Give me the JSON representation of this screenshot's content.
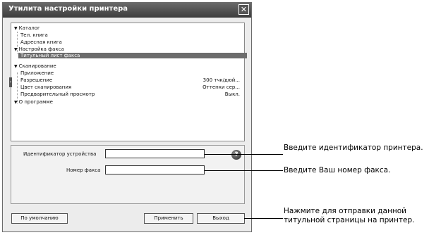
{
  "window": {
    "title": "Утилита настройки принтера",
    "close_glyph": "✕"
  },
  "tree": {
    "catalog": "Каталог",
    "phonebook": "Тел. книга",
    "address_book": "Адресная книга",
    "fax_settings": "Настройка факса",
    "fax_cover": "Титульный лист факса",
    "scanning": "Сканирование",
    "application": "Приложение",
    "resolution": "Разрешение",
    "resolution_value": "300 тчк/дюй...",
    "scan_color": "Цвет сканирования",
    "scan_color_value": "Оттенки сер...",
    "preview": "Предварительный просмотр",
    "preview_value": "Выкл.",
    "about": "О программе"
  },
  "form": {
    "device_id_label": "Идентификатор устройства",
    "device_id_value": "",
    "fax_number_label": "Номер факса",
    "fax_number_value": ""
  },
  "buttons": {
    "default": "По умолчанию",
    "apply": "Применить",
    "exit": "Выход"
  },
  "callouts": {
    "device_id": "Введите идентификатор принтера.",
    "fax_number": "Введите Ваш номер факса.",
    "send": "Нажмите для отправки данной титульной страницы на принтер."
  }
}
